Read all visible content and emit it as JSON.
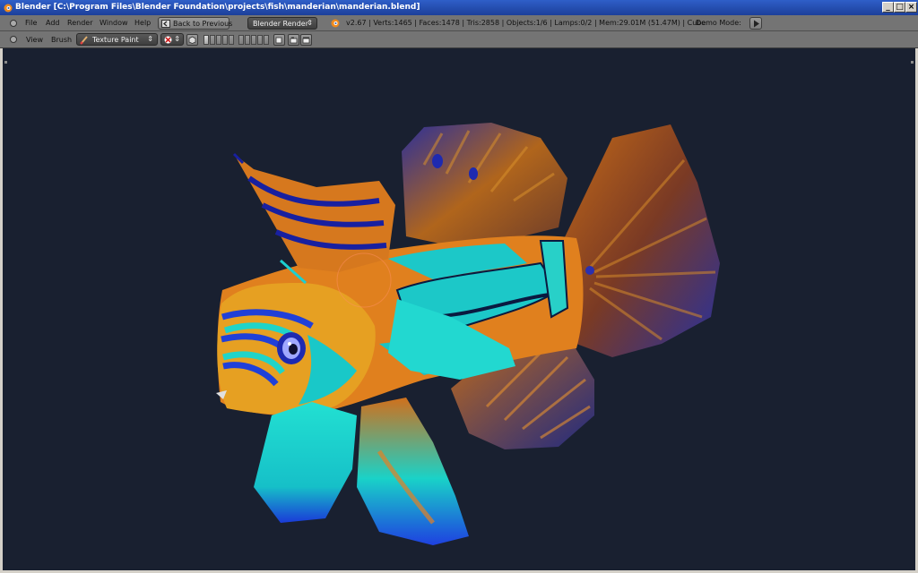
{
  "window": {
    "title": "Blender [C:\\Program Files\\Blender Foundation\\projects\\fish\\manderian\\manderian.blend]",
    "controls": [
      "_",
      "□",
      "×"
    ]
  },
  "info_header": {
    "menus": [
      "File",
      "Add",
      "Render",
      "Window",
      "Help"
    ],
    "back_button": "Back to Previous",
    "render_engine": "Blender Render",
    "stats": "v2.67 | Verts:1465 | Faces:1478 | Tris:2858 | Objects:1/6 | Lamps:0/2 | Mem:29.01M (51.47M) | Cube",
    "demo_mode_label": "Demo Mode:"
  },
  "view_header": {
    "menus": [
      "View",
      "Brush"
    ],
    "mode": "Texture Paint"
  },
  "colors": {
    "viewport_bg": "#192030",
    "header_bg": "#747474",
    "title_bg": "#1c3f9a"
  }
}
